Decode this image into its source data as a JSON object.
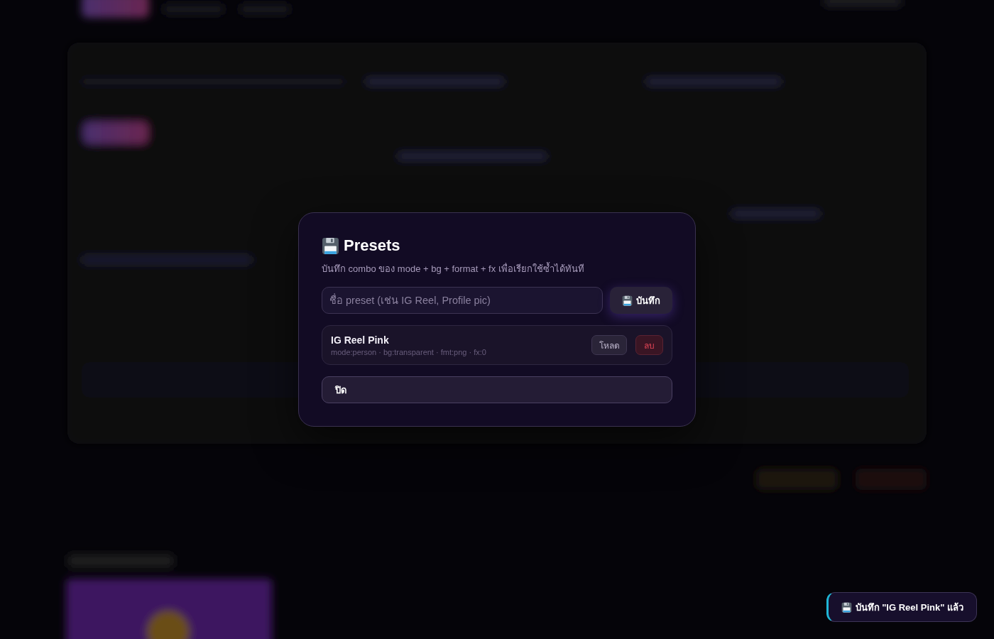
{
  "modal": {
    "title": "Presets",
    "description": "บันทึก combo ของ mode + bg + format + fx เพื่อเรียกใช้ซ้ำได้ทันที",
    "name_field": {
      "placeholder": "ชื่อ preset (เช่น IG Reel, Profile pic)"
    },
    "save_button": "บันทึก",
    "presets": [
      {
        "name": "IG Reel Pink",
        "details": "mode:person · bg:transparent · fmt:png · fx:0",
        "load_button": "โหลด",
        "delete_button": "ลบ"
      }
    ],
    "close_button": "ปิด"
  },
  "toast": {
    "message": "บันทึก \"IG Reel Pink\" แล้ว"
  }
}
